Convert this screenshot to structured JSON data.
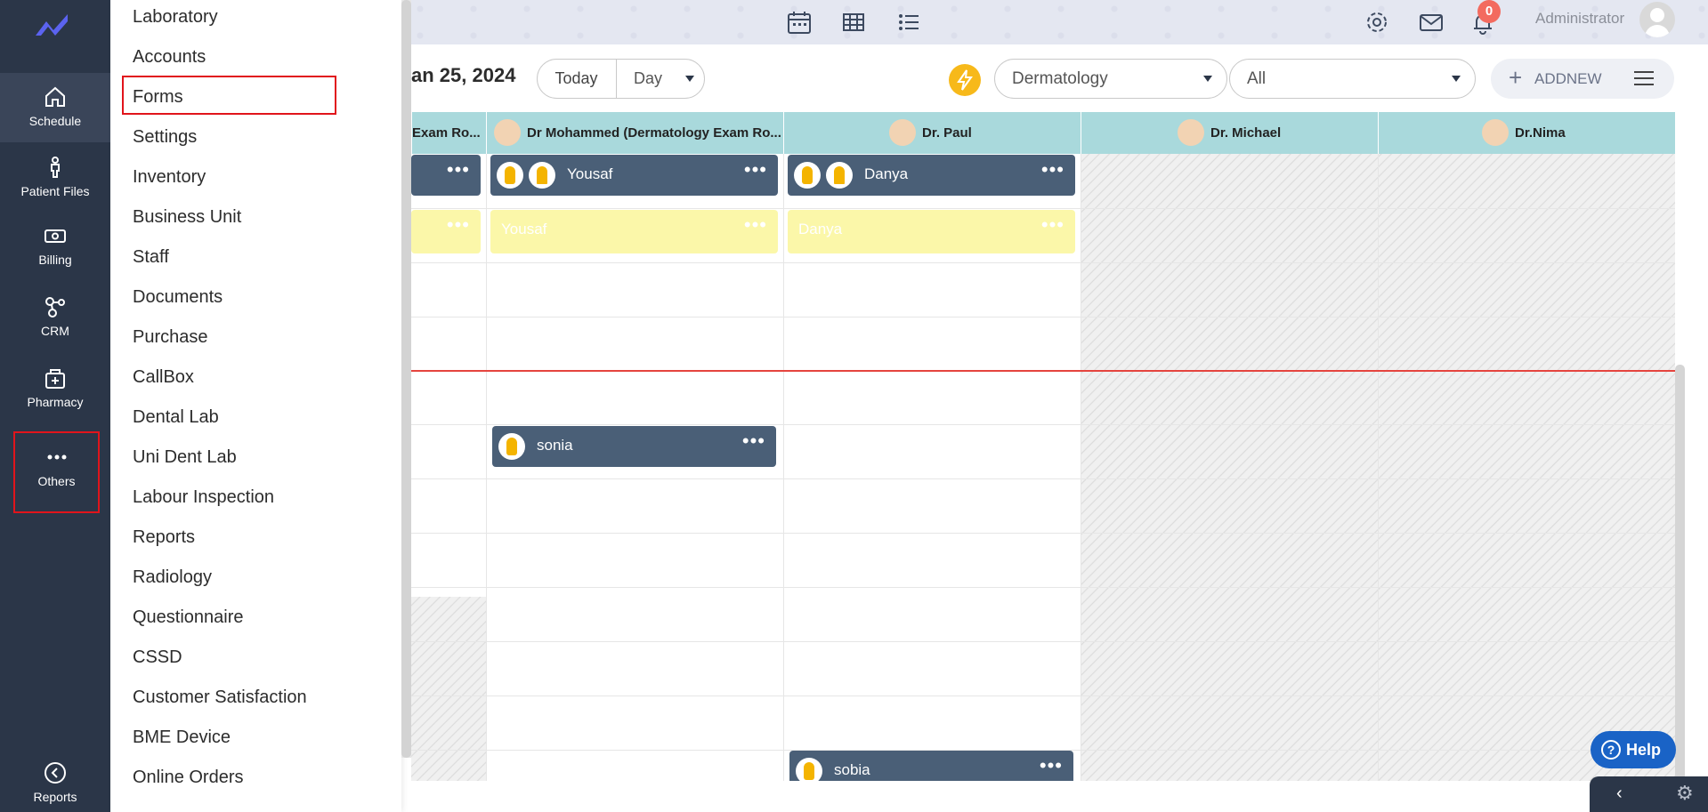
{
  "nav": {
    "items": [
      {
        "label": "Schedule",
        "icon": "home-icon"
      },
      {
        "label": "Patient Files",
        "icon": "person-icon"
      },
      {
        "label": "Billing",
        "icon": "billing-icon"
      },
      {
        "label": "CRM",
        "icon": "crm-icon"
      },
      {
        "label": "Pharmacy",
        "icon": "pharmacy-icon"
      },
      {
        "label": "Others",
        "icon": "more-icon"
      },
      {
        "label": "Reports",
        "icon": "back-circle-icon"
      }
    ]
  },
  "menu": {
    "items": [
      "Laboratory",
      "Accounts",
      "Forms",
      "Settings",
      "Inventory",
      "Business Unit",
      "Staff",
      "Documents",
      "Purchase",
      "CallBox",
      "Dental Lab",
      "Uni Dent Lab",
      "Labour Inspection",
      "Reports",
      "Radiology",
      "Questionnaire",
      "CSSD",
      "Customer Satisfaction",
      "BME Device",
      "Online Orders"
    ]
  },
  "header": {
    "user": "Administrator",
    "notification_count": "0"
  },
  "toolbar": {
    "date_title": "an 25, 2024",
    "today_label": "Today",
    "view_label": "Day",
    "department": "Dermatology",
    "filter": "All",
    "addnew_label": "ADDNEW"
  },
  "columns": [
    {
      "label": "Exam Ro..."
    },
    {
      "label": "Dr Mohammed (Dermatology Exam Ro..."
    },
    {
      "label": "Dr. Paul"
    },
    {
      "label": "Dr. Michael"
    },
    {
      "label": "Dr.Nima"
    }
  ],
  "appointments": [
    {
      "name": "",
      "status": "booked"
    },
    {
      "name": "Yousaf",
      "status": "booked"
    },
    {
      "name": "Danya",
      "status": "booked"
    },
    {
      "name": "",
      "status": "pending"
    },
    {
      "name": "Yousaf",
      "status": "pending"
    },
    {
      "name": "Danya",
      "status": "pending"
    },
    {
      "name": "sonia",
      "status": "booked"
    },
    {
      "name": "sobia",
      "status": "booked"
    }
  ],
  "help_label": "Help",
  "colors": {
    "rail_bg": "#2b3648",
    "header_bg": "#a9d9dc",
    "appointment_bg": "#4a5f77",
    "pending_bg": "#fbf7a9",
    "highlight": "#e1141b",
    "accent": "#f7b91a"
  }
}
